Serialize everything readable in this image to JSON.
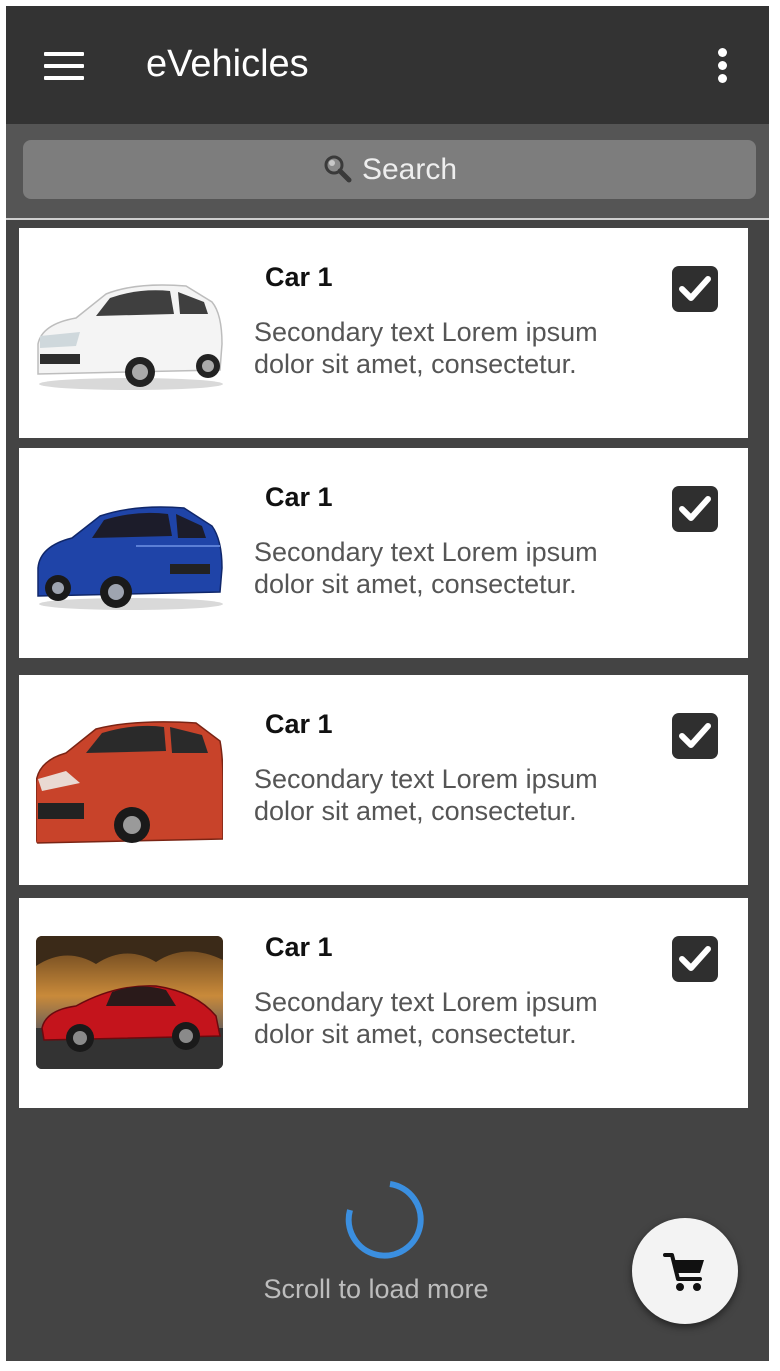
{
  "app": {
    "title": "eVehicles",
    "menu_icon": "hamburger-menu-icon",
    "more_icon": "more-vertical-icon"
  },
  "search": {
    "placeholder": "Search",
    "icon": "search-icon"
  },
  "cars": [
    {
      "title": "Car 1",
      "text": "Secondary text Lorem ipsum dolor sit amet, consectetur.",
      "checked": true,
      "image": "white-hatchback-car",
      "color": "#f2f2f2"
    },
    {
      "title": "Car 1",
      "text": "Secondary text Lorem ipsum dolor sit amet, consectetur.",
      "checked": true,
      "image": "blue-hatchback-car",
      "color": "#1f44a8"
    },
    {
      "title": "Car 1",
      "text": "Secondary text Lorem ipsum dolor sit amet, consectetur.",
      "checked": true,
      "image": "orange-red-hatchback-car",
      "color": "#c8432a"
    },
    {
      "title": "Car 1",
      "text": "Secondary text Lorem ipsum dolor sit amet, consectetur.",
      "checked": true,
      "image": "red-sports-car",
      "color": "#c4141c"
    }
  ],
  "footer": {
    "load_more": "Scroll to load more",
    "spinner_color": "#3b8fe0"
  },
  "fab": {
    "icon": "shopping-cart-icon"
  },
  "colors": {
    "appbar": "#333333",
    "background": "#444444",
    "search_bar": "#555555",
    "search_field": "#7d7d7d",
    "checkbox": "#2f2f2f"
  }
}
